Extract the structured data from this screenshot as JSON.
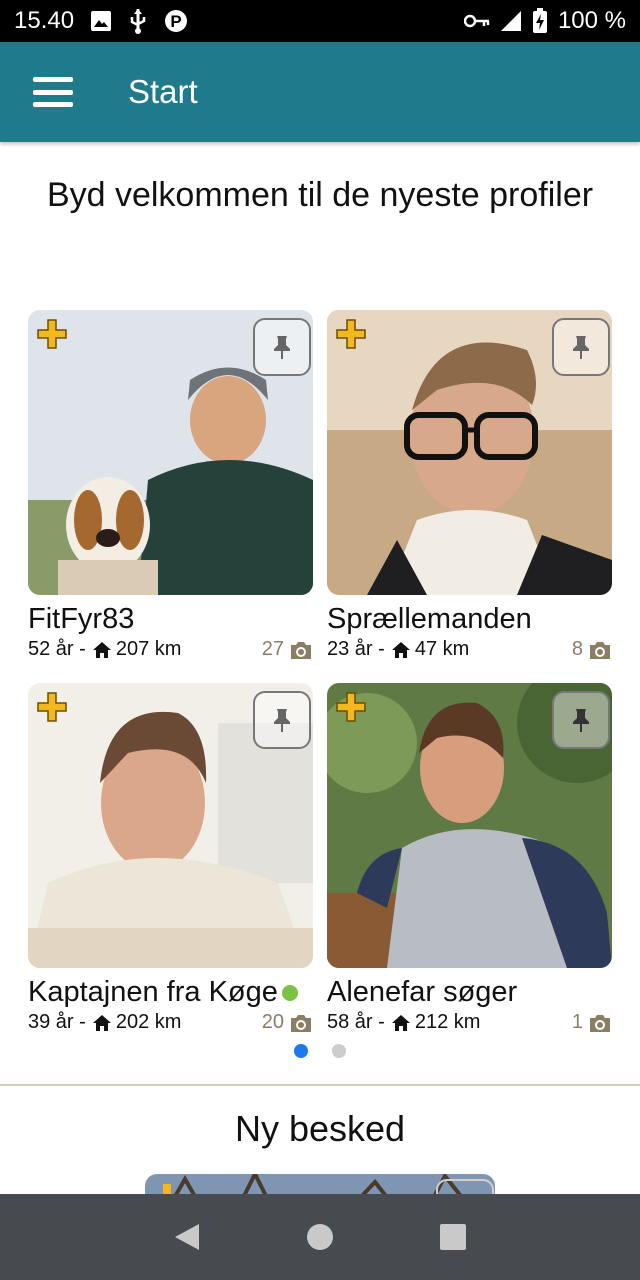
{
  "status_bar": {
    "time": "15.40",
    "battery": "100 %"
  },
  "app_bar": {
    "title": "Start"
  },
  "welcome": {
    "title": "Byd velkommen til de nyeste profiler"
  },
  "profiles": [
    {
      "name": "FitFyr83",
      "age": "52 år",
      "distance": "207 km",
      "photo_count": "27",
      "online": false
    },
    {
      "name": "Sprællemanden",
      "age": "23 år",
      "distance": "47 km",
      "photo_count": "8",
      "online": false
    },
    {
      "name": "Kaptajnen fra Køge",
      "age": "39 år",
      "distance": "202 km",
      "photo_count": "20",
      "online": true
    },
    {
      "name": "Alenefar søger",
      "age": "58 år",
      "distance": "212 km",
      "photo_count": "1",
      "online": false
    }
  ],
  "separator": "-",
  "pager": {
    "pages": 2,
    "active": 1
  },
  "new_message": {
    "title": "Ny besked"
  },
  "colors": {
    "app_bar": "#1f7a8c",
    "accent_plus": "#f2b81d",
    "online": "#7cc242",
    "photo_count": "#8a7e64",
    "pager_active": "#1e7be6",
    "nav_bar": "#474a4f"
  },
  "icons": {
    "status_left": [
      "image-icon",
      "usb-icon",
      "parking-icon"
    ],
    "status_right": [
      "key-icon",
      "signal-icon",
      "battery-charging-icon"
    ],
    "card": [
      "plus-icon",
      "pin-icon",
      "home-icon",
      "camera-icon"
    ],
    "nav": [
      "back-icon",
      "home-circle-icon",
      "recents-icon"
    ]
  }
}
